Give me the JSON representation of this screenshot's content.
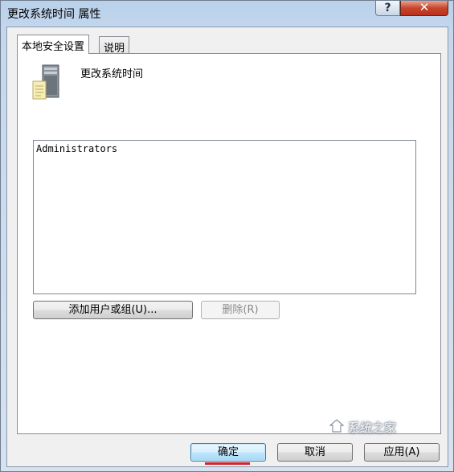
{
  "window": {
    "title": "更改系统时间 属性",
    "help_glyph": "?",
    "close_glyph": "✕"
  },
  "tabs": [
    {
      "label": "本地安全设置",
      "active": true
    },
    {
      "label": "说明",
      "active": false
    }
  ],
  "policy": {
    "name": "更改系统时间",
    "icon": "server-icon"
  },
  "members": {
    "items": [
      "Administrators"
    ]
  },
  "buttons": {
    "add": "添加用户或组(U)...",
    "remove": "删除(R)",
    "ok": "确定",
    "cancel": "取消",
    "apply": "应用(A)"
  },
  "watermark": "系统之家",
  "colors": {
    "highlight_underline": "#d2222e"
  }
}
